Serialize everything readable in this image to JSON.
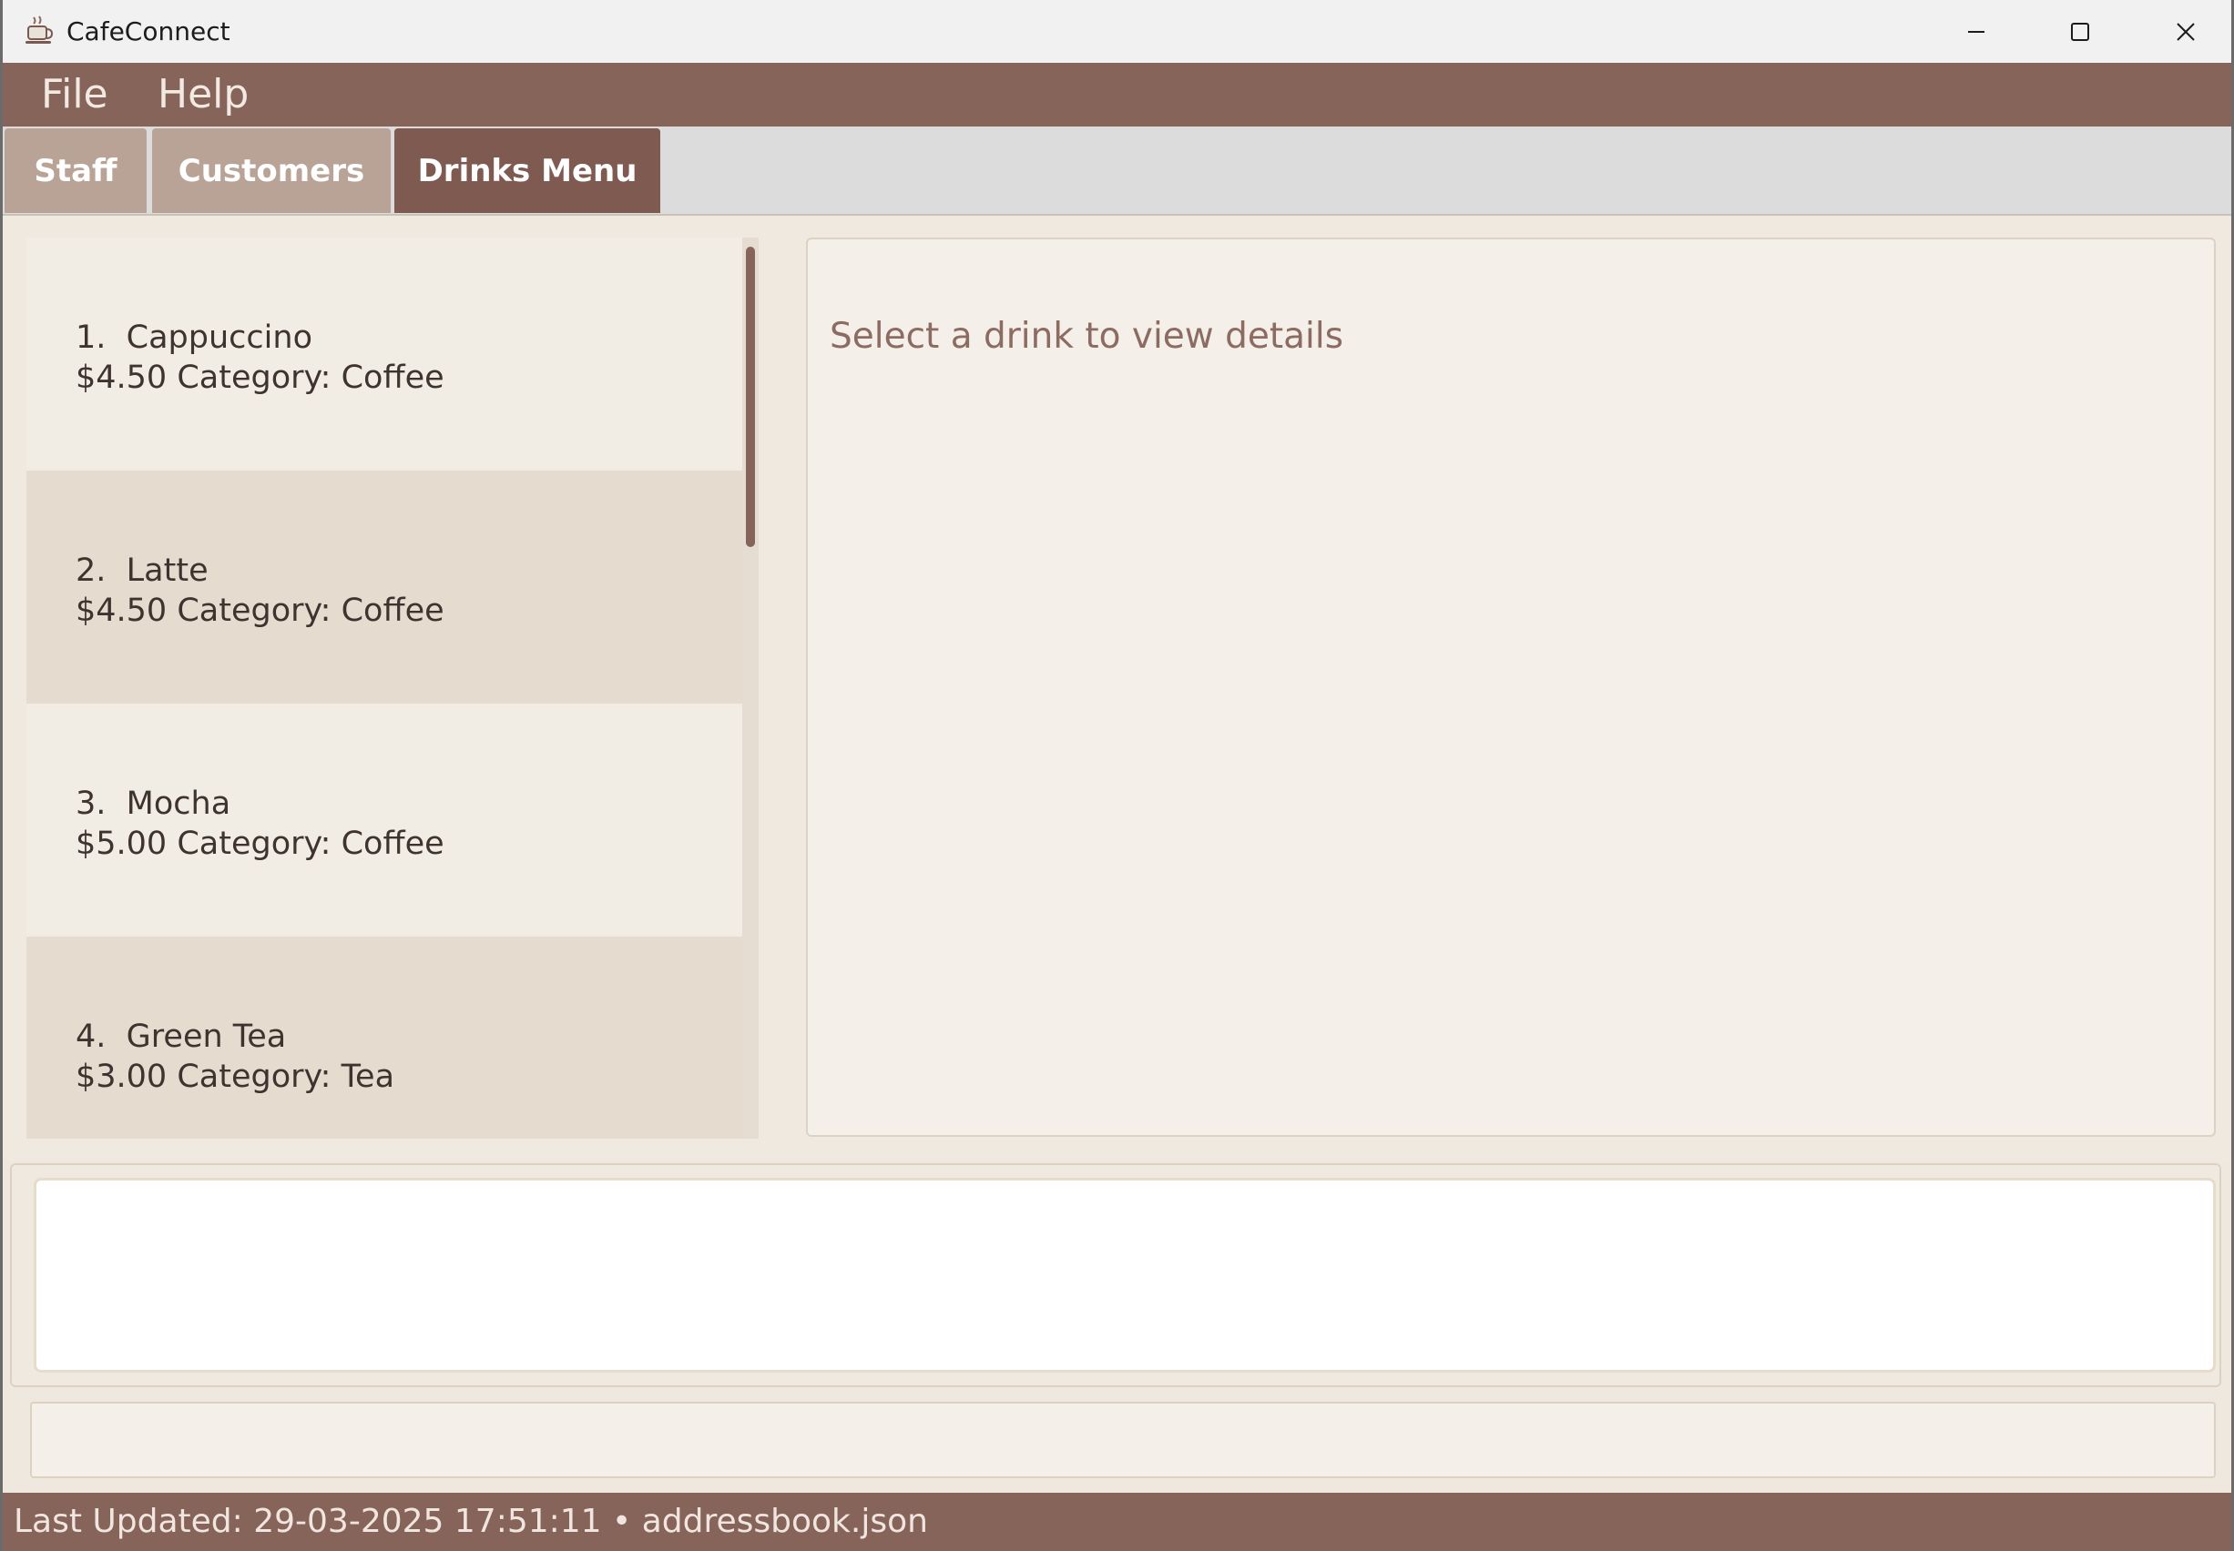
{
  "window": {
    "title": "CafeConnect",
    "icon": "coffee-cup-icon"
  },
  "menu": {
    "file_label": "File",
    "help_label": "Help"
  },
  "tabs": [
    {
      "label": "Staff",
      "active": false
    },
    {
      "label": "Customers",
      "active": false
    },
    {
      "label": "Drinks Menu",
      "active": true
    }
  ],
  "drinks": [
    {
      "index": "1.",
      "name": "Cappuccino",
      "price": "$4.50",
      "category_label": "Category:",
      "category": "Coffee"
    },
    {
      "index": "2.",
      "name": "Latte",
      "price": "$4.50",
      "category_label": "Category:",
      "category": "Coffee"
    },
    {
      "index": "3.",
      "name": "Mocha",
      "price": "$5.00",
      "category_label": "Category:",
      "category": "Coffee"
    },
    {
      "index": "4.",
      "name": "Green Tea",
      "price": "$3.00",
      "category_label": "Category:",
      "category": "Tea"
    }
  ],
  "detail": {
    "placeholder": "Select a drink to view details"
  },
  "command": {
    "value": ""
  },
  "result": {
    "text": ""
  },
  "status": {
    "text": "Last Updated: 29-03-2025 17:51:11 • addressbook.json"
  },
  "colors": {
    "accent": "#86645a",
    "active_tab": "#7f5a50",
    "inactive_tab": "#b8a396",
    "list_odd": "#f2ede4",
    "list_even": "#e5dccf"
  }
}
